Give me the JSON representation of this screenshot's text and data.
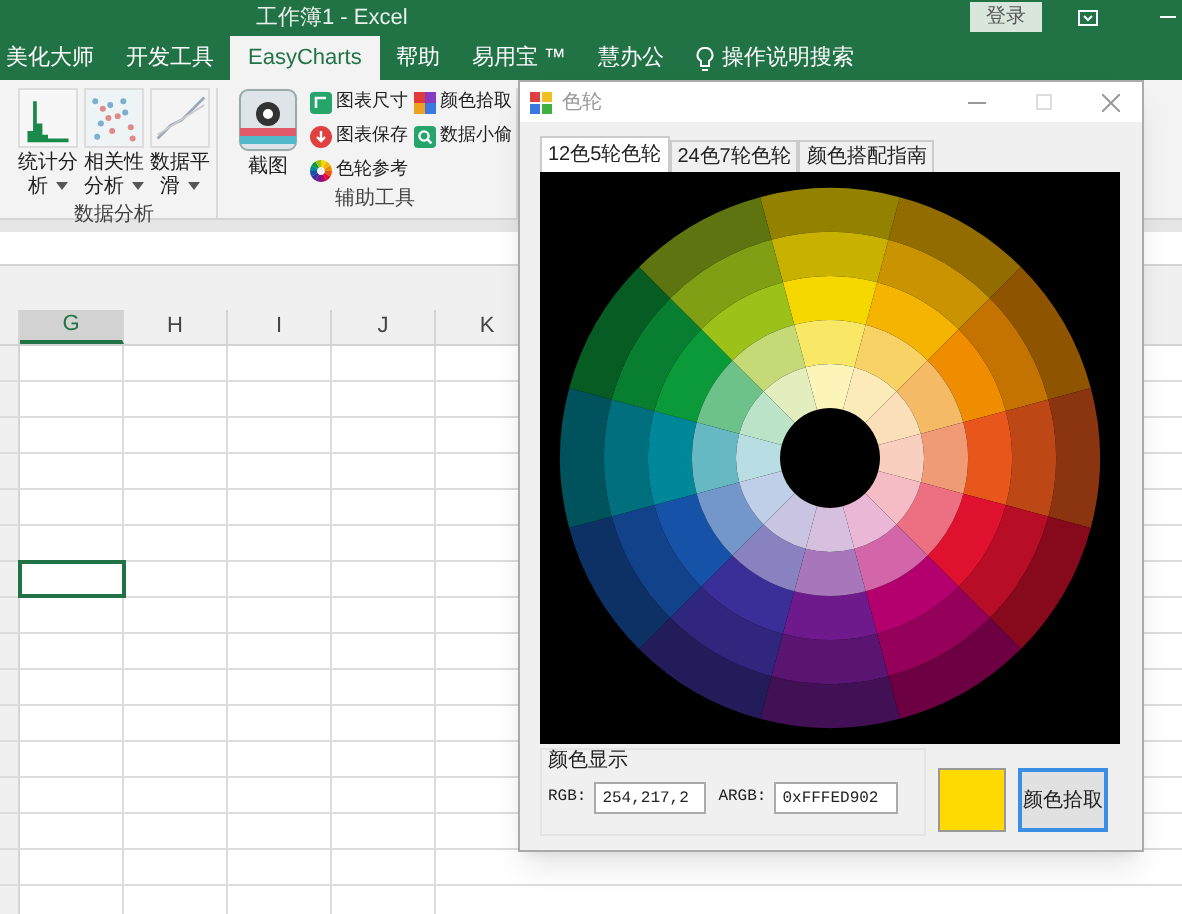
{
  "title_bar": {
    "title": "工作簿1  -  Excel",
    "login_button": "登录"
  },
  "ribbon_tabs": [
    {
      "label": "美化大师",
      "selected": false
    },
    {
      "label": "开发工具",
      "selected": false
    },
    {
      "label": "EasyCharts",
      "selected": true
    },
    {
      "label": "帮助",
      "selected": false
    },
    {
      "label": "易用宝 ™",
      "selected": false
    },
    {
      "label": "慧办公",
      "selected": false
    },
    {
      "label": "操作说明搜索",
      "selected": false,
      "kind": "search"
    }
  ],
  "ribbon_groups": [
    {
      "label": "数据分析",
      "large_buttons": [
        {
          "label": "统计分析",
          "kind": "histogram",
          "dropdown": true
        },
        {
          "label": "相关性分析",
          "kind": "scatter",
          "dropdown": true
        },
        {
          "label": "数据平滑",
          "kind": "smooth",
          "dropdown": true
        }
      ]
    },
    {
      "label": "辅助工具",
      "large_buttons": [
        {
          "label": "截图",
          "kind": "camera",
          "dropdown": false
        }
      ],
      "small_buttons": [
        {
          "label": "图表尺寸",
          "kind": "resize"
        },
        {
          "label": "图表保存",
          "kind": "save"
        },
        {
          "label": "色轮参考",
          "kind": "wheel"
        },
        {
          "label": "颜色拾取",
          "kind": "picker"
        },
        {
          "label": "数据小偷",
          "kind": "search"
        }
      ]
    }
  ],
  "sheet": {
    "columns": [
      {
        "label": "G",
        "selected": true
      },
      {
        "label": "H",
        "selected": false
      },
      {
        "label": "I",
        "selected": false
      },
      {
        "label": "J",
        "selected": false
      },
      {
        "label": "K",
        "selected": false
      }
    ],
    "rows": [
      {
        "cells": [
          {
            "selected": false
          }
        ]
      },
      {
        "cells": [
          {
            "selected": false
          }
        ]
      },
      {
        "cells": [
          {
            "selected": false
          }
        ]
      },
      {
        "cells": [
          {
            "selected": false
          }
        ]
      },
      {
        "cells": [
          {
            "selected": false
          }
        ]
      },
      {
        "cells": [
          {
            "selected": false
          }
        ]
      },
      {
        "cells": [
          {
            "selected": true
          }
        ]
      },
      {
        "cells": [
          {
            "selected": false
          }
        ]
      },
      {
        "cells": [
          {
            "selected": false
          }
        ]
      },
      {
        "cells": [
          {
            "selected": false
          }
        ]
      },
      {
        "cells": [
          {
            "selected": false
          }
        ]
      },
      {
        "cells": [
          {
            "selected": false
          }
        ]
      },
      {
        "cells": [
          {
            "selected": false
          }
        ]
      },
      {
        "cells": [
          {
            "selected": false
          }
        ]
      },
      {
        "cells": [
          {
            "selected": false
          }
        ]
      },
      {
        "cells": [
          {
            "selected": false
          }
        ]
      }
    ]
  },
  "dialog": {
    "title": "色轮",
    "tabs": [
      {
        "label": "12色5轮色轮",
        "selected": true
      },
      {
        "label": "24色7轮色轮",
        "selected": false
      },
      {
        "label": "颜色搭配指南",
        "selected": false
      }
    ],
    "group_label": "颜色显示",
    "rgb_label": "RGB:",
    "rgb_value": "254,217,2",
    "argb_label": "ARGB:",
    "argb_value": "0xFFFED902",
    "swatch": {
      "color": "#fed902"
    },
    "pick_button": "颜色拾取"
  }
}
